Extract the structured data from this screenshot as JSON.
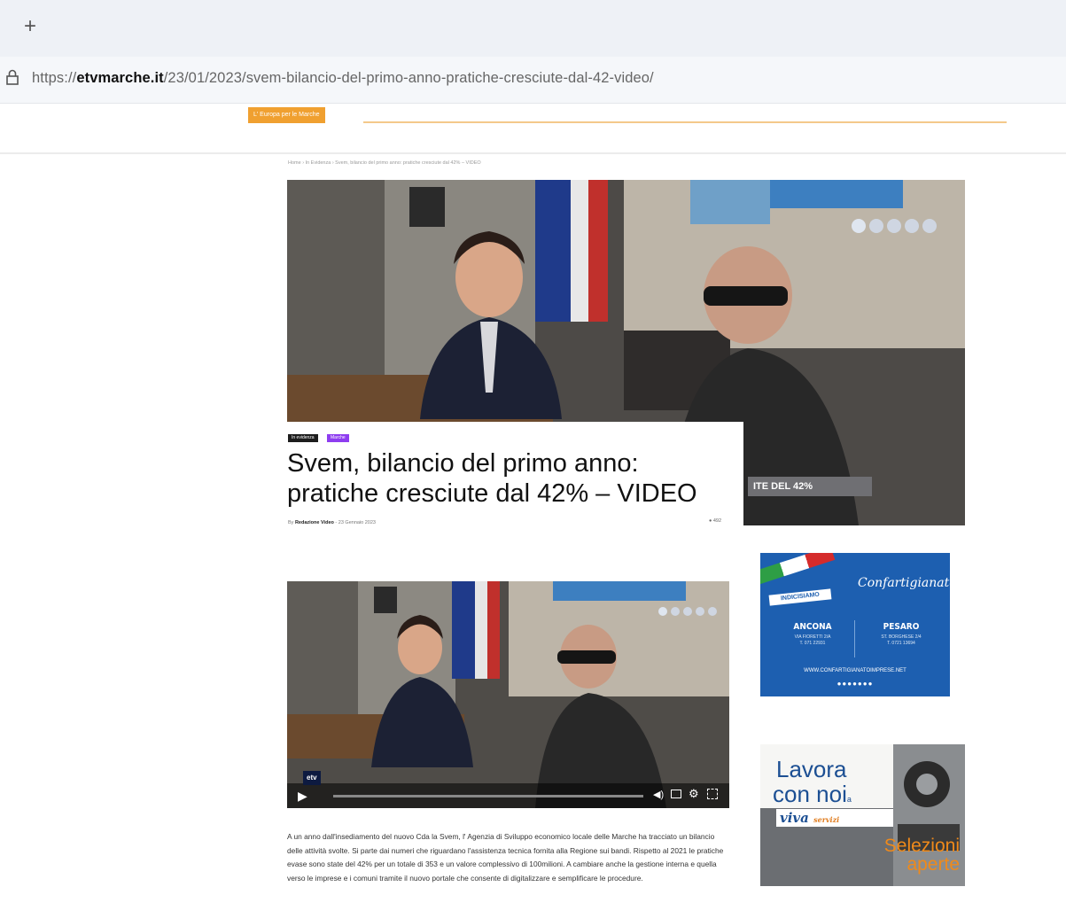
{
  "browser": {
    "new_tab_symbol": "+",
    "url_prefix": "https://",
    "url_domain": "etvmarche.it",
    "url_path": "/23/01/2023/svem-bilancio-del-primo-anno-pratiche-cresciute-dal-42-video/"
  },
  "site": {
    "category_tab": "L' Europa per le Marche",
    "breadcrumb": "Home  ›  In Evidenza  ›  Svem, bilancio del primo anno: pratiche cresciute dal 42% – VIDEO"
  },
  "article": {
    "badges": [
      "In evidenza",
      "Marche"
    ],
    "title": "Svem, bilancio del primo anno: pratiche cresciute dal 42% – VIDEO",
    "byline_prefix": "By",
    "author": "Redazione Video",
    "date": "23 Gennaio 2023",
    "views": "492",
    "hero_overlay_text": "ITE DEL 42%",
    "video_logo": "etv",
    "body": "A un anno dall'insediamento del nuovo Cda la Svem, l' Agenzia di Sviluppo economico locale delle Marche ha tracciato un bilancio delle attività svolte. Si parte dai numeri che riguardano l'assistenza tecnica fornita alla Regione sui bandi. Rispetto al 2021 le pratiche evase sono state del 42% per un totale di 353 e un valore complessivo di 100milioni. A cambiare anche la gestione interna e quella verso le imprese e i comuni tramite il nuovo portale che consente di digitalizzare e semplificare le procedure."
  },
  "ads": {
    "confartigianato": {
      "brand": "Confartigianato",
      "tag": "INDICISIAMO",
      "city1": "ANCONA",
      "addr1": "VIA FIORETTI 2/A\nT. 071 22931",
      "city2": "PESARO",
      "addr2": "ST. BORGHESE 2/4\nT. 0721 13694",
      "website": "WWW.CONFARTIGIANATOIMPRESE.NET",
      "dots": "●●●●●●●"
    },
    "viva": {
      "line1": "Lavora",
      "line2": "con noi",
      "line2_suffix": "a",
      "brand": "viva",
      "brand_suffix": "servizi",
      "line3": "Selezioni",
      "line4": "aperte"
    }
  },
  "colors": {
    "category_orange": "#f0a030",
    "badge_purple": "#8e3df0",
    "ad_blue": "#1d5fb0",
    "ad_orange": "#f08a1a"
  },
  "icons": [
    "plus-icon",
    "lock-icon",
    "play-icon",
    "volume-icon",
    "captions-icon",
    "settings-gear-icon",
    "fullscreen-icon",
    "eye-icon"
  ]
}
